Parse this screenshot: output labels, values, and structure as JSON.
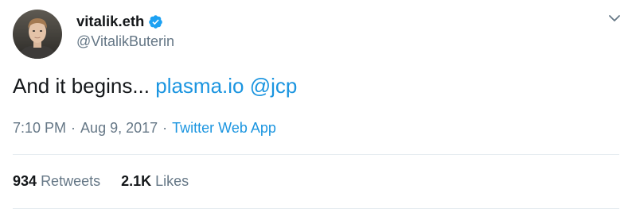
{
  "user": {
    "display_name": "vitalik.eth",
    "handle": "@VitalikButerin",
    "verified": true
  },
  "tweet": {
    "text_plain": "And it begins...",
    "links": [
      "plasma.io",
      "@jcp"
    ]
  },
  "meta": {
    "time": "7:10 PM",
    "separator": "·",
    "date": "Aug 9, 2017",
    "source": "Twitter Web App"
  },
  "stats": {
    "retweets_count": "934",
    "retweets_label": "Retweets",
    "likes_count": "2.1K",
    "likes_label": "Likes"
  },
  "icons": {
    "verified": "verified-badge-icon",
    "caret": "chevron-down-icon"
  },
  "colors": {
    "link": "#1b95e0",
    "text": "#14171a",
    "secondary": "#657786",
    "divider": "#e6ecf0"
  }
}
